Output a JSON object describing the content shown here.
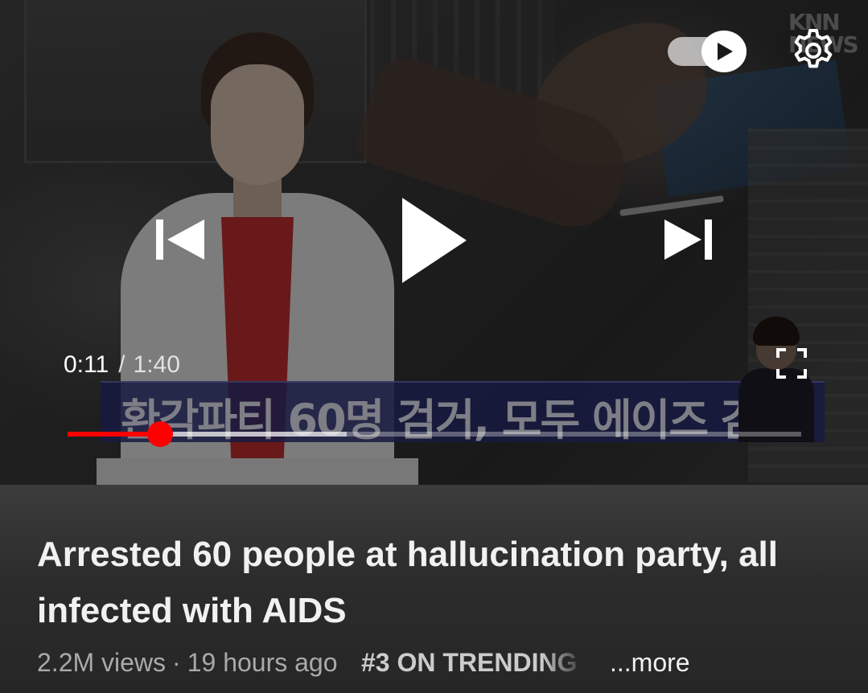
{
  "player": {
    "headline_korean": "환각파티 60명 검거, 모두 에이즈 감염",
    "watermark": "KNN NEWS",
    "current_time": "0:11",
    "time_separator": "/",
    "duration": "1:40",
    "progress_fraction": 0.126,
    "buffered_fraction": 0.381,
    "autoplay_on": true,
    "icons": {
      "prev": "skip-previous-icon",
      "play": "play-icon",
      "next": "skip-next-icon",
      "settings": "gear-icon",
      "fullscreen": "fullscreen-icon",
      "autoplay": "autoplay-play-icon"
    },
    "accent_color": "#ff0000"
  },
  "video": {
    "title": "Arrested 60 people at hallucination party, all infected with AIDS",
    "views": "2.2M views",
    "meta_separator": "·",
    "uploaded": "19 hours ago",
    "trending": "#3 ON TRENDING",
    "more_label": "...more"
  }
}
